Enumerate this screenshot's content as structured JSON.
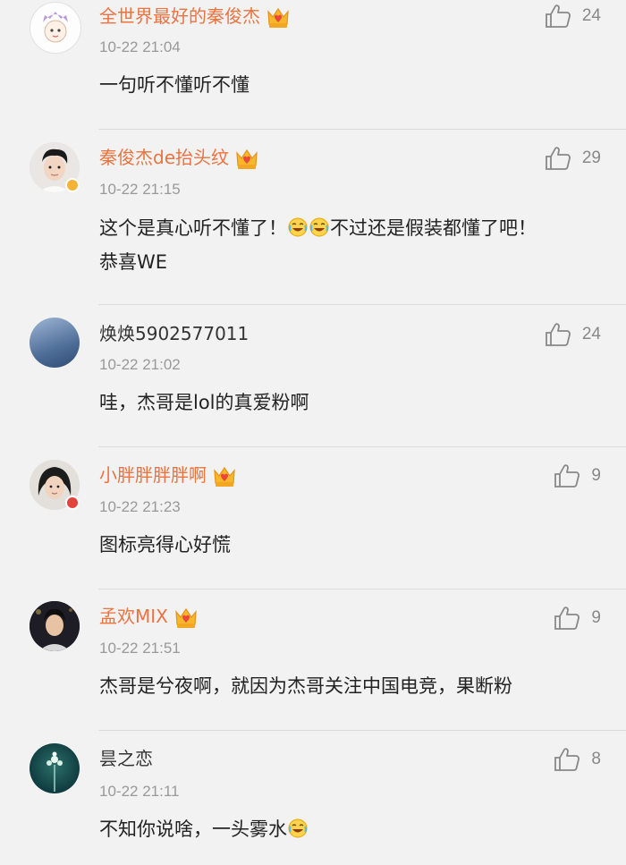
{
  "comments": [
    {
      "name": "全世界最好的秦俊杰",
      "time": "10-22 21:04",
      "text": "一句听不懂听不懂",
      "likes": "24",
      "vip": true
    },
    {
      "name": "秦俊杰de抬头纹",
      "time": "10-22 21:15",
      "text_1": "这个是真心听不懂了！",
      "text_2": "不过还是假装都懂了吧！",
      "text_3": "恭喜WE",
      "likes": "29",
      "vip": true
    },
    {
      "name": "焕焕5902577011",
      "time": "10-22 21:02",
      "text": "哇，杰哥是lol的真爱粉啊",
      "likes": "24",
      "vip": false
    },
    {
      "name": "小胖胖胖胖啊",
      "time": "10-22 21:23",
      "text": "图标亮得心好慌",
      "likes": "9",
      "vip": true
    },
    {
      "name": "孟欢MIX",
      "time": "10-22 21:51",
      "text": "杰哥是兮夜啊，就因为杰哥关注中国电竞，果断粉",
      "likes": "9",
      "vip": true
    },
    {
      "name": "昙之恋",
      "time": "10-22 21:11",
      "text": "不知你说啥，一头雾水",
      "likes": "8",
      "vip": false
    }
  ],
  "icons": {
    "like": "thumbs-up-icon",
    "crown": "vip-crown-icon",
    "emoji": "laughing-crying-emoji-icon"
  },
  "colors": {
    "vip_name": "#eb7340",
    "timestamp": "#999999",
    "background": "#f2f2f2"
  }
}
